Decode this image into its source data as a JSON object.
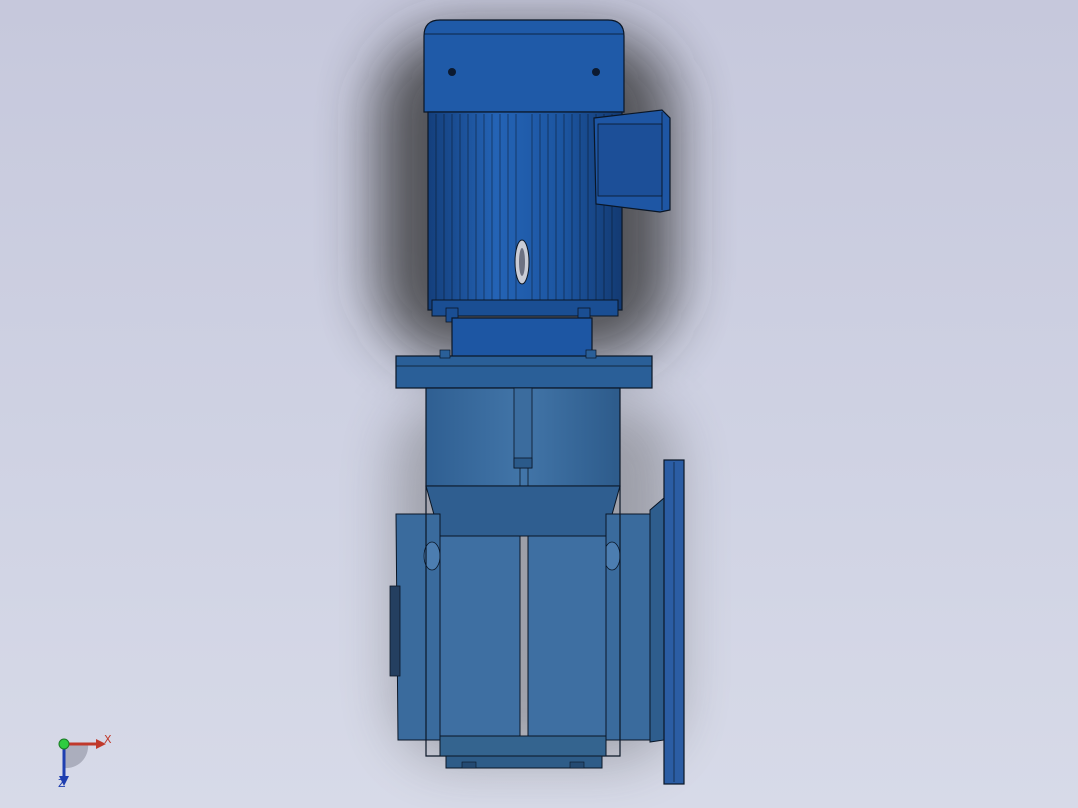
{
  "viewport": {
    "background_top": "#c6c8dc",
    "background_bottom": "#d7dae8"
  },
  "model": {
    "motor_color": "#1e56a4",
    "gearbox_color": "#3a6d9f",
    "outline_color": "#0a1626",
    "shadow_color": "#3a3a3a"
  },
  "triad": {
    "x_label": "X",
    "z_label": "Z",
    "x_color": "#c0392b",
    "y_color": "#2ecc40",
    "z_color": "#1f3fb0"
  }
}
